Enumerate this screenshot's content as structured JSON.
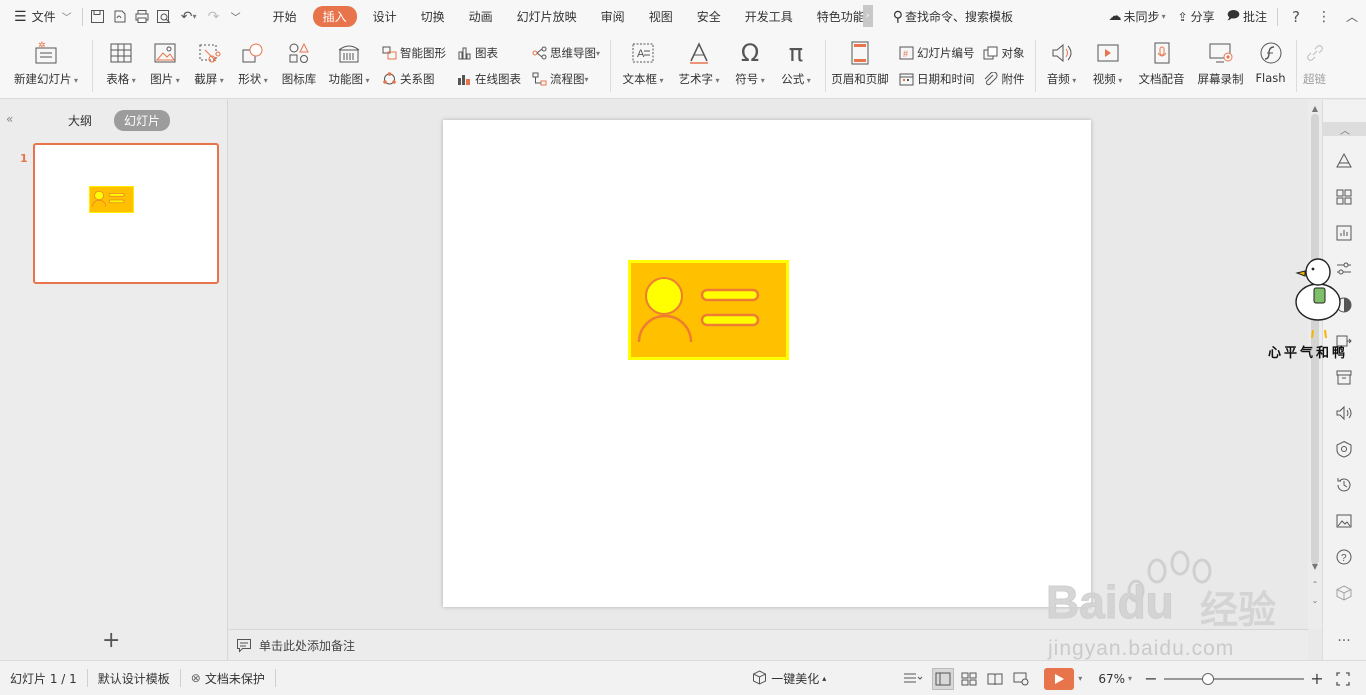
{
  "menubar": {
    "file_label": "文件",
    "tabs": [
      {
        "label": "开始",
        "active": false
      },
      {
        "label": "插入",
        "active": true
      },
      {
        "label": "设计",
        "active": false
      },
      {
        "label": "切换",
        "active": false
      },
      {
        "label": "动画",
        "active": false
      },
      {
        "label": "幻灯片放映",
        "active": false
      },
      {
        "label": "审阅",
        "active": false
      },
      {
        "label": "视图",
        "active": false
      },
      {
        "label": "安全",
        "active": false
      },
      {
        "label": "开发工具",
        "active": false
      },
      {
        "label": "特色功能",
        "active": false
      }
    ],
    "search_label": "查找命令、搜索模板",
    "sync_label": "未同步",
    "share_label": "分享",
    "comment_label": "批注"
  },
  "ribbon": {
    "new_slide": "新建幻灯片",
    "table": "表格",
    "picture": "图片",
    "screenshot": "截屏",
    "shape": "形状",
    "icon_lib": "图标库",
    "func_chart": "功能图",
    "smart_art": "智能图形",
    "relation": "关系图",
    "chart": "图表",
    "online_chart": "在线图表",
    "mindmap": "思维导图",
    "flowchart": "流程图",
    "textbox": "文本框",
    "wordart": "艺术字",
    "symbol": "符号",
    "formula": "公式",
    "header_footer": "页眉和页脚",
    "slide_number": "幻灯片编号",
    "datetime": "日期和时间",
    "object": "对象",
    "attachment": "附件",
    "audio": "音频",
    "video": "视频",
    "doc_voice": "文档配音",
    "screen_record": "屏幕录制",
    "flash": "Flash",
    "hyperlink": "超链"
  },
  "leftpanel": {
    "tab_outline": "大纲",
    "tab_slides": "幻灯片",
    "slide_number": "1"
  },
  "notes": {
    "placeholder": "单击此处添加备注"
  },
  "statusbar": {
    "slide_info": "幻灯片 1 / 1",
    "template": "默认设计模板",
    "protect": "文档未保护",
    "beautify": "一键美化",
    "zoom": "67%",
    "zoom_level_fraction": 0.3
  },
  "watermark": {
    "duck_text": "心平气和鸭",
    "baidu_brand": "Baidu",
    "baidu_cn": "经验",
    "baidu_url": "jingyan.baidu.com"
  },
  "colors": {
    "accent": "#e8744b",
    "card_fill": "#ffc000",
    "card_border": "#ffff00",
    "card_icon_stroke": "#ed7d31"
  }
}
